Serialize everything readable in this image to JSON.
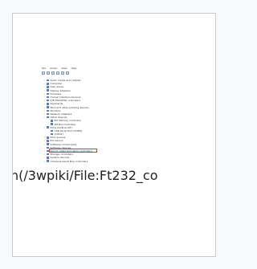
{
  "thumbnail": {
    "menu": [
      "File",
      "Action",
      "View",
      "Help"
    ],
    "tree": [
      {
        "label": "Audio inputs and outputs",
        "level": 0
      },
      {
        "label": "Computer",
        "level": 0
      },
      {
        "label": "Disk drives",
        "level": 0
      },
      {
        "label": "Display adapters",
        "level": 0
      },
      {
        "label": "Firmware",
        "level": 0
      },
      {
        "label": "Human Interface Devices",
        "level": 0
      },
      {
        "label": "IDE ATA/ATAPI controllers",
        "level": 0
      },
      {
        "label": "Keyboards",
        "level": 0
      },
      {
        "label": "Mice and other pointing devices",
        "level": 0
      },
      {
        "label": "Monitors",
        "level": 0
      },
      {
        "label": "Network adapters",
        "level": 0
      },
      {
        "label": "Other devices",
        "level": 0
      },
      {
        "label": "PCI Memory Controller",
        "level": 1
      },
      {
        "label": "SM Bus Controller",
        "level": 1
      },
      {
        "label": "Ports (COM & LPT)",
        "level": 0
      },
      {
        "label": "USB Serial Port (COM4)",
        "level": 1
      },
      {
        "label": "(COM1)",
        "level": 1
      },
      {
        "label": "Print queues",
        "level": 0
      },
      {
        "label": "Processors",
        "level": 0
      },
      {
        "label": "Software components",
        "level": 0
      },
      {
        "label": "Software devices",
        "level": 0
      },
      {
        "label": "Sound, video and game controllers",
        "level": 0
      },
      {
        "label": "Storage controllers",
        "level": 0
      },
      {
        "label": "System devices",
        "level": 0
      },
      {
        "label": "Universal Serial Bus controllers",
        "level": 0
      }
    ]
  },
  "broken_link": {
    "url": "n(/3wpiki/File:Ft232_co"
  }
}
